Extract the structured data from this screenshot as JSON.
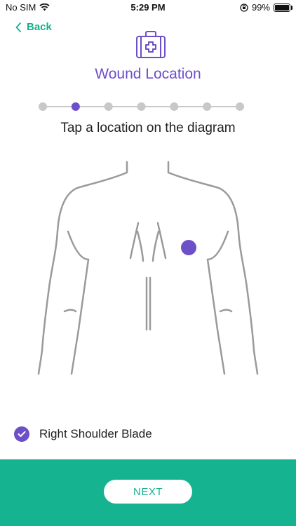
{
  "status_bar": {
    "carrier": "No SIM",
    "time": "5:29 PM",
    "battery_percent": "99%",
    "battery_level": 0.99
  },
  "nav": {
    "back_label": "Back"
  },
  "header": {
    "icon": "first-aid-kit-icon",
    "title": "Wound Location"
  },
  "stepper": {
    "total_steps": 7,
    "current_step": 2
  },
  "instruction": "Tap a location on the diagram",
  "diagram": {
    "view": "back",
    "marker": "right-shoulder-blade-marker"
  },
  "selection": {
    "label": "Right Shoulder Blade"
  },
  "footer": {
    "next_label": "NEXT"
  },
  "colors": {
    "accent_purple": "#6d4fc9",
    "accent_green": "#15b390",
    "step_inactive": "#c8c8c8",
    "outline_gray": "#9a9a9a"
  }
}
